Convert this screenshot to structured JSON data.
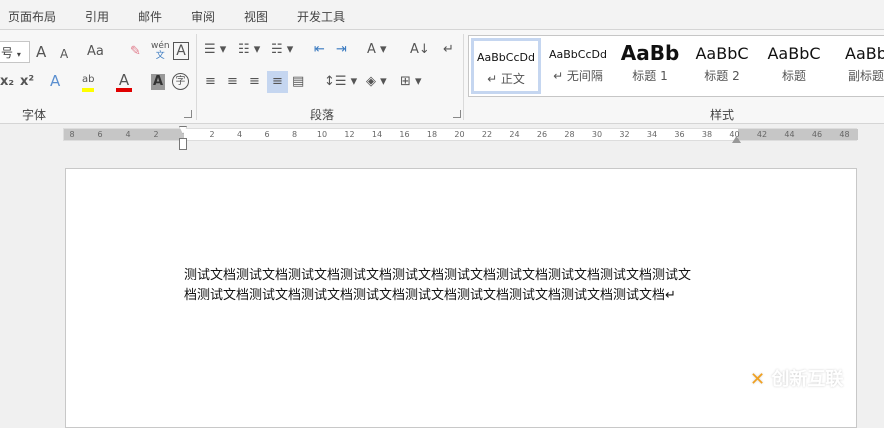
{
  "tabs": [
    "页面布局",
    "引用",
    "邮件",
    "审阅",
    "视图",
    "开发工具"
  ],
  "font": {
    "size_value": "号",
    "group_label": "字体",
    "grow": "A",
    "shrink": "A",
    "case": "Aa",
    "phonetic": "wén",
    "phonetic_char": "文",
    "border_char": "A",
    "sub": "x₂",
    "sup": "x²",
    "effects": "A",
    "highlight": "ab",
    "color": "A",
    "shading": "A",
    "enclose": "字"
  },
  "paragraph": {
    "group_label": "段落"
  },
  "styles": {
    "group_label": "样式",
    "items": [
      {
        "sample": "AaBbCcDd",
        "name": "↵ 正文"
      },
      {
        "sample": "AaBbCcDd",
        "name": "↵ 无间隔"
      },
      {
        "sample": "AaBb",
        "name": "标题 1"
      },
      {
        "sample": "AaBbC",
        "name": "标题 2"
      },
      {
        "sample": "AaBbC",
        "name": "标题"
      },
      {
        "sample": "AaBb",
        "name": "副标题"
      }
    ]
  },
  "ruler": {
    "left": [
      "8",
      "6",
      "4",
      "2"
    ],
    "right": [
      "2",
      "4",
      "6",
      "8",
      "10",
      "12",
      "14",
      "16",
      "18",
      "20",
      "22",
      "24",
      "26",
      "28",
      "30",
      "32",
      "34",
      "36",
      "38",
      "40",
      "42",
      "44",
      "46",
      "48"
    ]
  },
  "document": {
    "line1": "测试文档测试文档测试文档测试文档测试文档测试文档测试文档测试文档测试文档测试文",
    "line2": "档测试文档测试文档测试文档测试文档测试文档测试文档测试文档测试文档测试文档↵"
  },
  "watermark": "创新互联",
  "colors": {
    "highlight": "#ffff00",
    "font_color": "#e00000",
    "selected": "#c5d6f0"
  }
}
